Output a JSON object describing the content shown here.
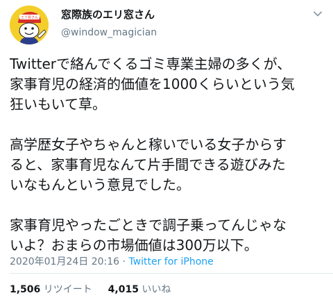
{
  "user": {
    "display_name": "窓際族のエリ窓さん",
    "handle": "@window_magician",
    "avatar_icon": "avatar-character-icon",
    "avatar_badge_text": "エリ窓さん"
  },
  "tweet": {
    "paragraphs": [
      "Twitterで絡んでくるゴミ専業主婦の多くが、\n家事育児の経済的価値を1000くらいという気\n狂いもいて草。",
      "高学歴女子やちゃんと稼いでいる女子からす\nると、家事育児なんて片手間できる遊びみた\nいなもんという意見でした。",
      "家事育児やったごときで調子乗ってんじゃな\nいよ？おまらの市場価値は300万以下。"
    ],
    "timestamp": "2020年01月24日 20:16",
    "separator": " · ",
    "source": "Twitter for iPhone"
  },
  "stats": {
    "retweets_count": "1,506",
    "retweets_label": "リツイート",
    "likes_count": "4,015",
    "likes_label": "いいね"
  },
  "colors": {
    "text": "#14171a",
    "muted": "#657786",
    "link": "#1da1f2",
    "avatar_bg": "#f4cf2b"
  }
}
